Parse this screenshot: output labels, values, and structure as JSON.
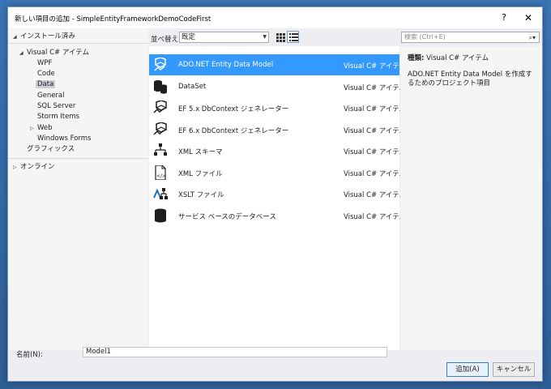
{
  "window": {
    "title": "新しい項目の追加 - SimpleEntityFrameworkDemoCodeFirst",
    "help_label": "?",
    "close_label": "✕"
  },
  "tree": {
    "installed": "インストール済み",
    "visual_csharp": "Visual C# アイテム",
    "children": [
      "WPF",
      "Code",
      "Data",
      "General",
      "SQL Server",
      "Storm Items",
      "Web",
      "Windows Forms"
    ],
    "graphics": "グラフィックス",
    "online": "オンライン",
    "selected": "Data"
  },
  "toolbar": {
    "sort_label": "並べ替え:",
    "sort_value": "既定",
    "search_placeholder": "検索 (Ctrl+E)"
  },
  "templates": [
    {
      "name": "ADO.NET Entity Data Model",
      "type": "Visual C# アイテム",
      "icon": "entity-model-icon",
      "selected": true
    },
    {
      "name": "DataSet",
      "type": "Visual C# アイテム",
      "icon": "database-icon",
      "selected": false
    },
    {
      "name": "EF 5.x DbContext ジェネレーター",
      "type": "Visual C# アイテム",
      "icon": "ef-generator-icon",
      "selected": false
    },
    {
      "name": "EF 6.x DbContext ジェネレーター",
      "type": "Visual C# アイテム",
      "icon": "ef-generator-icon",
      "selected": false
    },
    {
      "name": "XML スキーマ",
      "type": "Visual C# アイテム",
      "icon": "xml-schema-icon",
      "selected": false
    },
    {
      "name": "XML ファイル",
      "type": "Visual C# アイテム",
      "icon": "xml-file-icon",
      "selected": false
    },
    {
      "name": "XSLT ファイル",
      "type": "Visual C# アイテム",
      "icon": "xslt-icon",
      "selected": false
    },
    {
      "name": "サービス ベースのデータベース",
      "type": "Visual C# アイテム",
      "icon": "database-icon",
      "selected": false
    }
  ],
  "details": {
    "type_label": "種類:",
    "type_value": "Visual C# アイテム",
    "description": "ADO.NET Entity Data Model を作成するためのプロジェクト項目"
  },
  "footer": {
    "name_label": "名前(N):",
    "name_value": "Model1",
    "add_label": "追加(A)",
    "cancel_label": "キャンセル"
  },
  "colors": {
    "accent": "#3399ff",
    "dialog_bg": "#eeeef2",
    "panel_bg": "#f5f5f5"
  }
}
